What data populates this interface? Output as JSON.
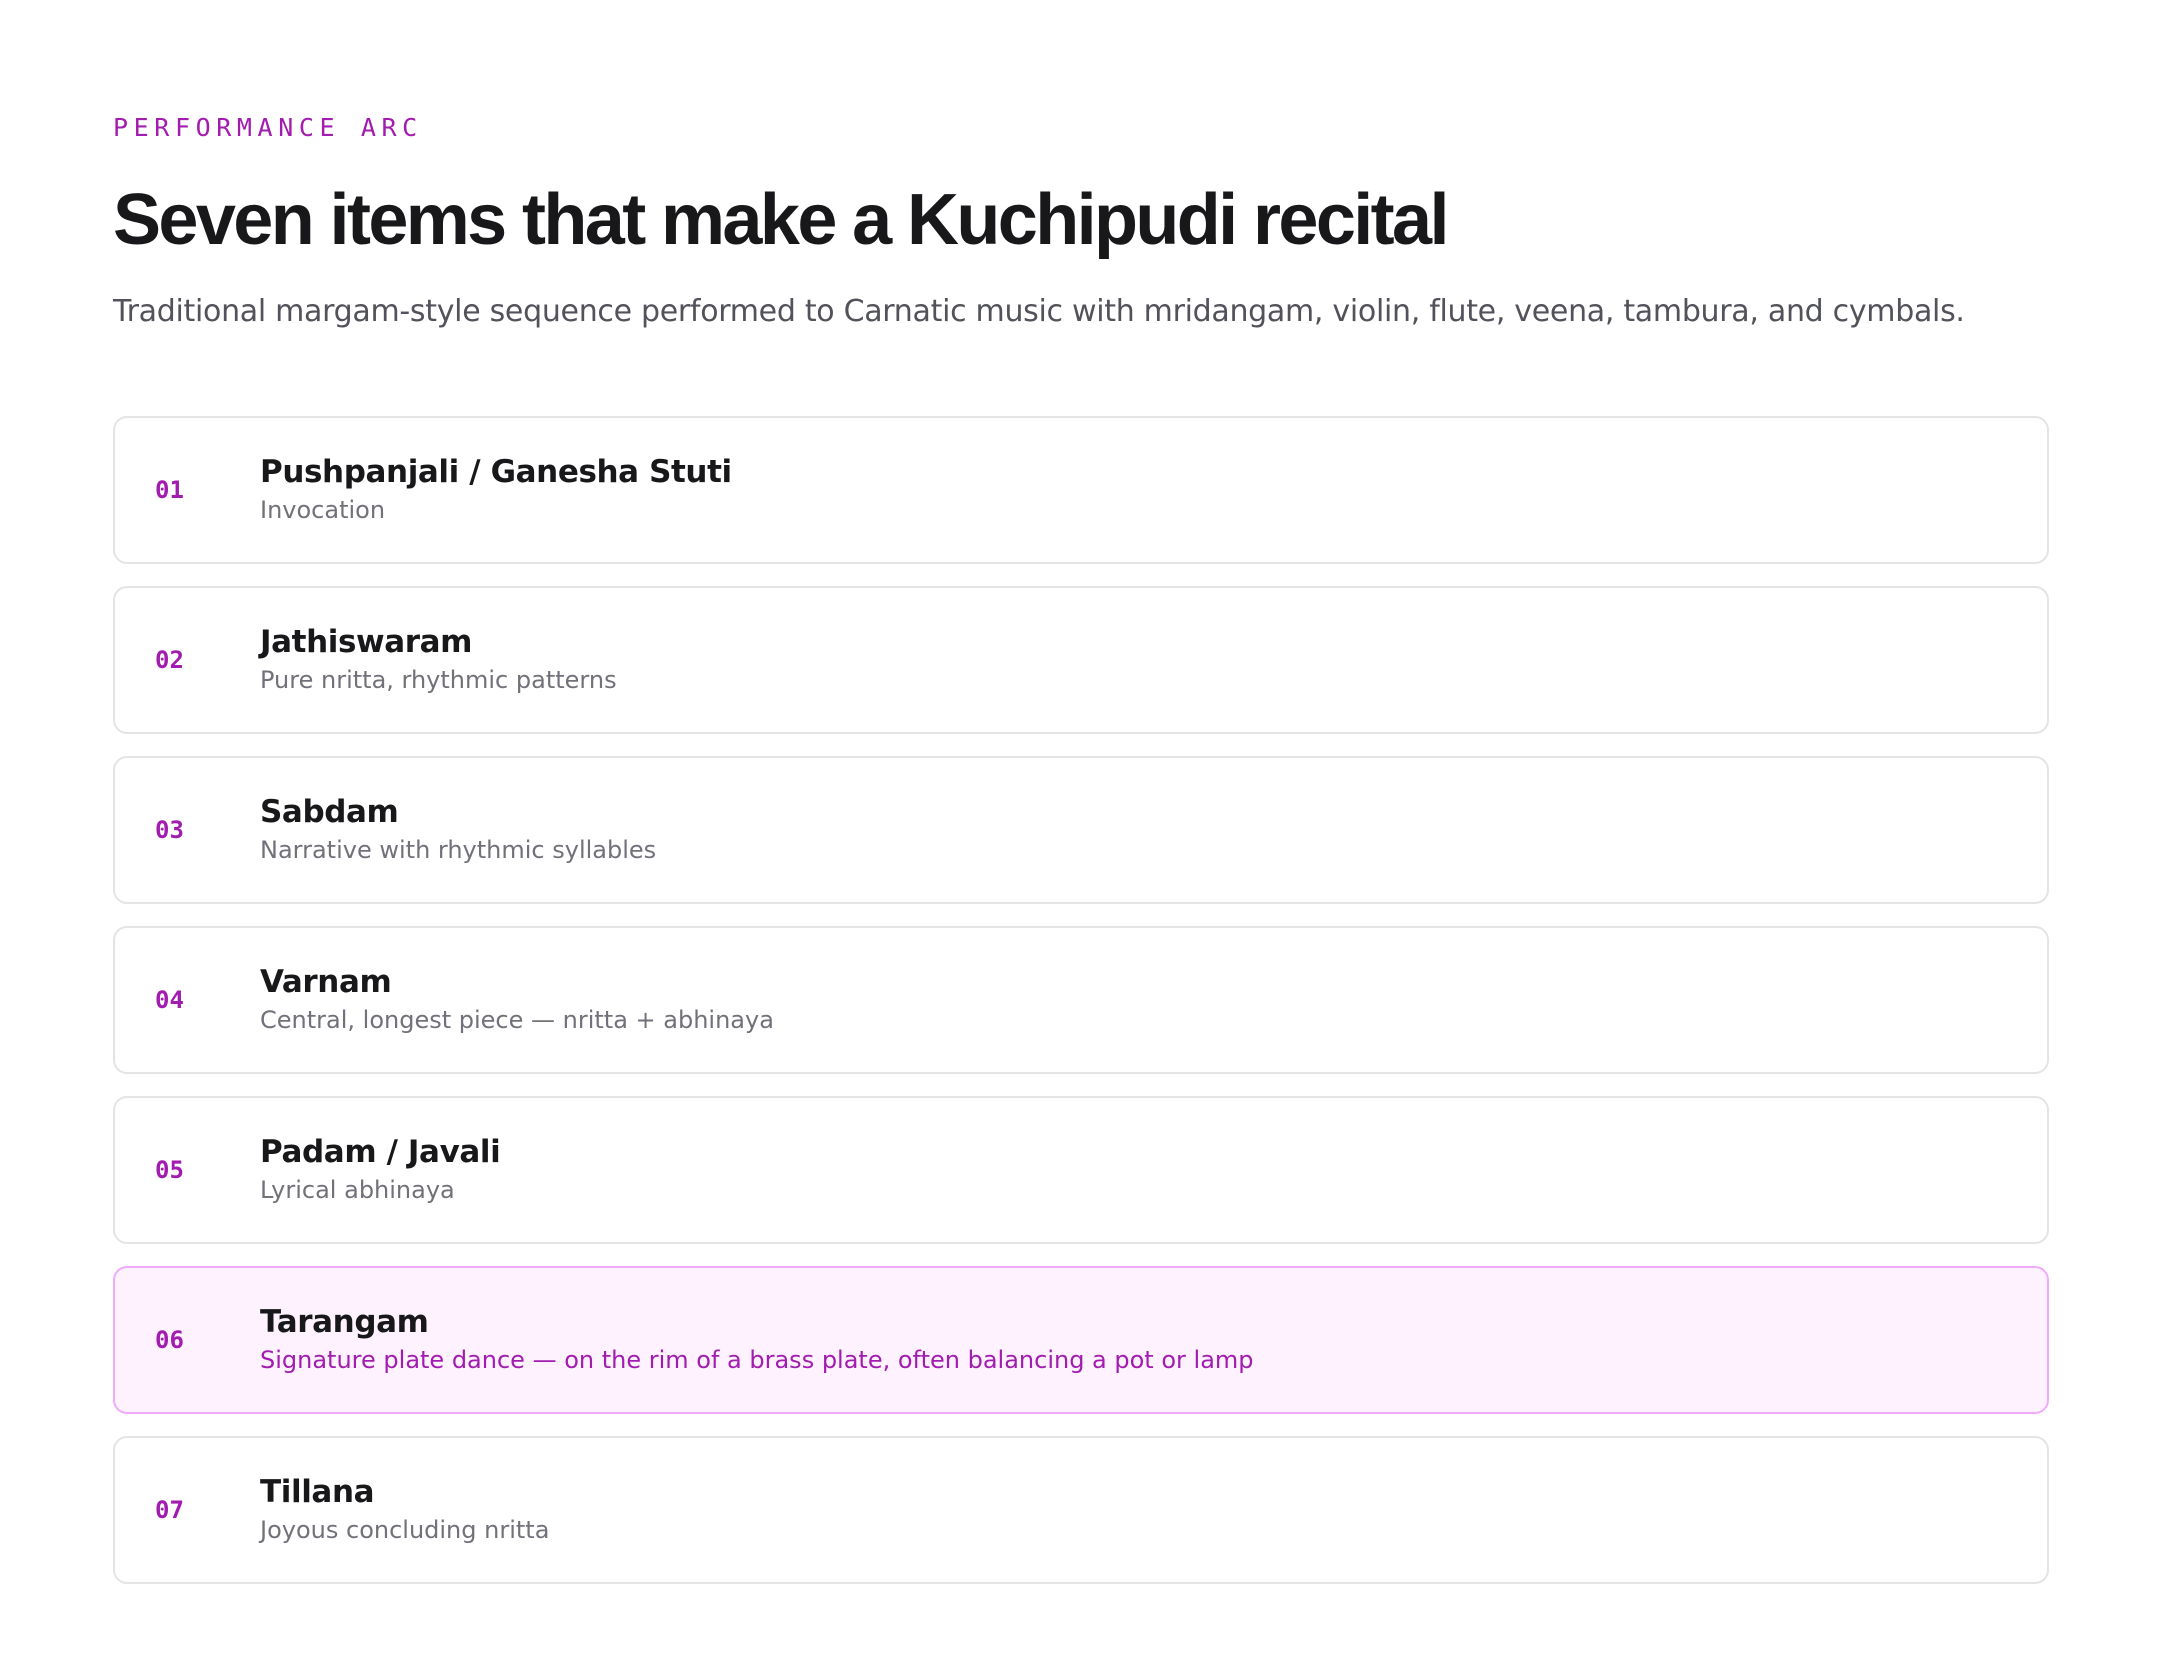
{
  "header": {
    "eyebrow": "PERFORMANCE ARC",
    "title": "Seven items that make a Kuchipudi recital",
    "subtitle": "Traditional margam-style sequence performed to Carnatic music with mridangam, violin, flute, veena, tambura, and cymbals."
  },
  "items": [
    {
      "number": "01",
      "name": "Pushpanjali / Ganesha Stuti",
      "description": "Invocation",
      "highlighted": false
    },
    {
      "number": "02",
      "name": "Jathiswaram",
      "description": "Pure nritta, rhythmic patterns",
      "highlighted": false
    },
    {
      "number": "03",
      "name": "Sabdam",
      "description": "Narrative with rhythmic syllables",
      "highlighted": false
    },
    {
      "number": "04",
      "name": "Varnam",
      "description": "Central, longest piece — nritta + abhinaya",
      "highlighted": false
    },
    {
      "number": "05",
      "name": "Padam / Javali",
      "description": "Lyrical abhinaya",
      "highlighted": false
    },
    {
      "number": "06",
      "name": "Tarangam",
      "description": "Signature plate dance — on the rim of a brass plate, often balancing a pot or lamp",
      "highlighted": true
    },
    {
      "number": "07",
      "name": "Tillana",
      "description": "Joyous concluding nritta",
      "highlighted": false
    }
  ],
  "colors": {
    "accent": "#a21caf",
    "highlight_background": "#fdf2fd",
    "highlight_border": "#f0abfc",
    "card_border": "#e4e4e7"
  }
}
